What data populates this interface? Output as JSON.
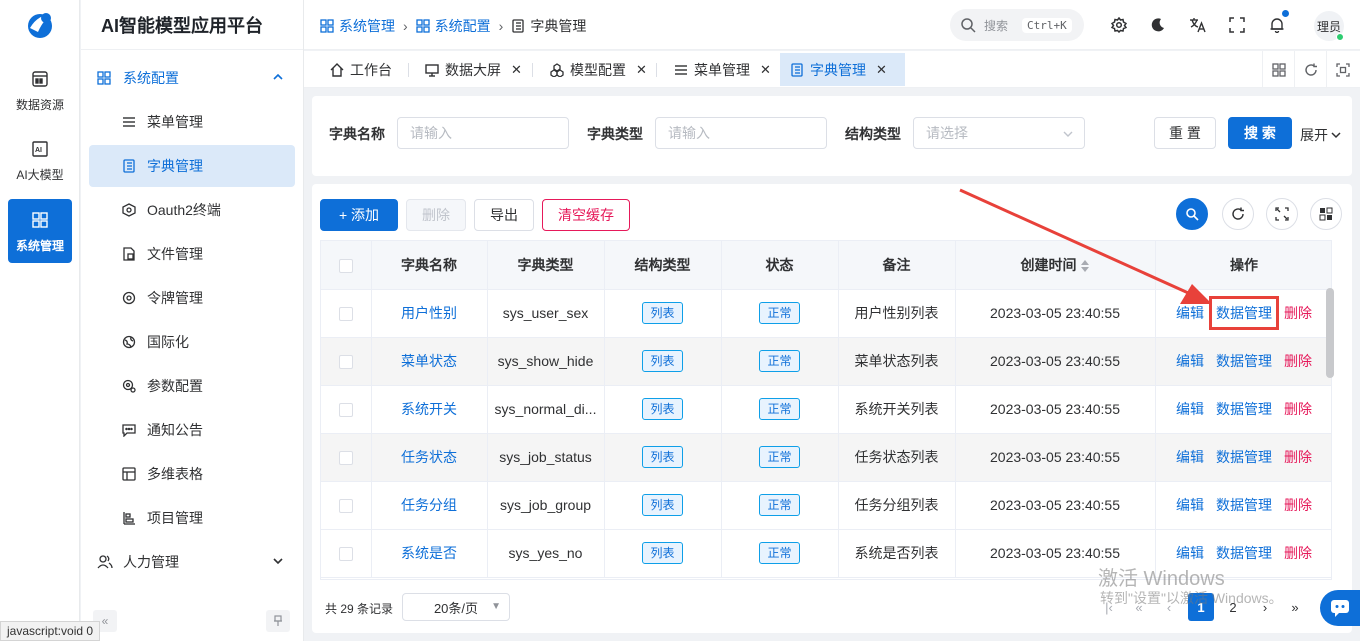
{
  "app": {
    "brand": "AI智能模型应用平台",
    "status_url": "javascript:void 0"
  },
  "rail": [
    {
      "label": "数据资源",
      "icon": "dashboard-icon"
    },
    {
      "label": "AI大模型",
      "icon": "ai-chip-icon"
    },
    {
      "label": "系统管理",
      "icon": "system-grid-icon",
      "active": true
    }
  ],
  "sidebar": {
    "group_open": "系统配置",
    "items": [
      {
        "label": "菜单管理",
        "icon": "menu-list-icon"
      },
      {
        "label": "字典管理",
        "icon": "dictionary-icon",
        "active": true
      },
      {
        "label": "Oauth2终端",
        "icon": "oauth-hex-icon"
      },
      {
        "label": "文件管理",
        "icon": "file-icon"
      },
      {
        "label": "令牌管理",
        "icon": "token-icon"
      },
      {
        "label": "国际化",
        "icon": "globe-icon"
      },
      {
        "label": "参数配置",
        "icon": "params-gear-icon"
      },
      {
        "label": "通知公告",
        "icon": "notice-chat-icon"
      },
      {
        "label": "多维表格",
        "icon": "multi-table-icon"
      },
      {
        "label": "项目管理",
        "icon": "project-icon"
      }
    ],
    "group_closed": "人力管理"
  },
  "header": {
    "breadcrumb": [
      "系统管理",
      "系统配置",
      "字典管理"
    ],
    "search_placeholder": "搜索",
    "search_shortcut": "Ctrl+K",
    "avatar_text": "理员"
  },
  "tabs": [
    {
      "label": "工作台",
      "icon": "home-icon",
      "closable": false
    },
    {
      "label": "数据大屏",
      "icon": "monitor-icon",
      "closable": true
    },
    {
      "label": "模型配置",
      "icon": "model-icon",
      "closable": true
    },
    {
      "label": "菜单管理",
      "icon": "menu-list-icon",
      "closable": true
    },
    {
      "label": "字典管理",
      "icon": "dictionary-icon",
      "closable": true,
      "active": true
    }
  ],
  "search_form": {
    "name_label": "字典名称",
    "name_placeholder": "请输入",
    "type_label": "字典类型",
    "type_placeholder": "请输入",
    "struct_label": "结构类型",
    "struct_placeholder": "请选择",
    "reset_label": "重 置",
    "search_label": "搜 索",
    "expand_label": "展开"
  },
  "toolbar": {
    "add_label": "+ 添加",
    "delete_label": "删除",
    "export_label": "导出",
    "clear_cache_label": "清空缓存"
  },
  "table": {
    "columns": [
      "字典名称",
      "字典类型",
      "结构类型",
      "状态",
      "备注",
      "创建时间",
      "操作"
    ],
    "rows": [
      {
        "name": "用户性别",
        "type": "sys_user_sex",
        "struct": "列表",
        "status": "正常",
        "remark": "用户性别列表",
        "created": "2023-03-05 23:40:55"
      },
      {
        "name": "菜单状态",
        "type": "sys_show_hide",
        "struct": "列表",
        "status": "正常",
        "remark": "菜单状态列表",
        "created": "2023-03-05 23:40:55"
      },
      {
        "name": "系统开关",
        "type": "sys_normal_di...",
        "struct": "列表",
        "status": "正常",
        "remark": "系统开关列表",
        "created": "2023-03-05 23:40:55"
      },
      {
        "name": "任务状态",
        "type": "sys_job_status",
        "struct": "列表",
        "status": "正常",
        "remark": "任务状态列表",
        "created": "2023-03-05 23:40:55"
      },
      {
        "name": "任务分组",
        "type": "sys_job_group",
        "struct": "列表",
        "status": "正常",
        "remark": "任务分组列表",
        "created": "2023-03-05 23:40:55"
      },
      {
        "name": "系统是否",
        "type": "sys_yes_no",
        "struct": "列表",
        "status": "正常",
        "remark": "系统是否列表",
        "created": "2023-03-05 23:40:55"
      }
    ],
    "actions": {
      "edit": "编辑",
      "data": "数据管理",
      "delete": "删除"
    }
  },
  "pager": {
    "total_text": "共 29 条记录",
    "page_size": "20条/页",
    "pages": [
      "1",
      "2"
    ],
    "current": "1"
  },
  "watermark": {
    "line1": "激活 Windows",
    "line2": "转到\"设置\"以激活 Windows。"
  },
  "colors": {
    "primary": "#0e6fd8",
    "danger": "#e6195a",
    "annotation": "#e8413a"
  }
}
